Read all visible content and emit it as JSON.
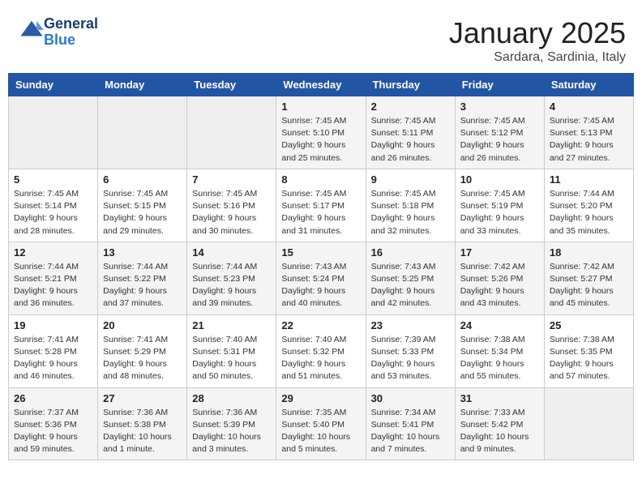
{
  "header": {
    "logo_line1": "General",
    "logo_line2": "Blue",
    "month": "January 2025",
    "location": "Sardara, Sardinia, Italy"
  },
  "weekdays": [
    "Sunday",
    "Monday",
    "Tuesday",
    "Wednesday",
    "Thursday",
    "Friday",
    "Saturday"
  ],
  "weeks": [
    [
      {
        "day": "",
        "info": ""
      },
      {
        "day": "",
        "info": ""
      },
      {
        "day": "",
        "info": ""
      },
      {
        "day": "1",
        "info": "Sunrise: 7:45 AM\nSunset: 5:10 PM\nDaylight: 9 hours and 25 minutes."
      },
      {
        "day": "2",
        "info": "Sunrise: 7:45 AM\nSunset: 5:11 PM\nDaylight: 9 hours and 26 minutes."
      },
      {
        "day": "3",
        "info": "Sunrise: 7:45 AM\nSunset: 5:12 PM\nDaylight: 9 hours and 26 minutes."
      },
      {
        "day": "4",
        "info": "Sunrise: 7:45 AM\nSunset: 5:13 PM\nDaylight: 9 hours and 27 minutes."
      }
    ],
    [
      {
        "day": "5",
        "info": "Sunrise: 7:45 AM\nSunset: 5:14 PM\nDaylight: 9 hours and 28 minutes."
      },
      {
        "day": "6",
        "info": "Sunrise: 7:45 AM\nSunset: 5:15 PM\nDaylight: 9 hours and 29 minutes."
      },
      {
        "day": "7",
        "info": "Sunrise: 7:45 AM\nSunset: 5:16 PM\nDaylight: 9 hours and 30 minutes."
      },
      {
        "day": "8",
        "info": "Sunrise: 7:45 AM\nSunset: 5:17 PM\nDaylight: 9 hours and 31 minutes."
      },
      {
        "day": "9",
        "info": "Sunrise: 7:45 AM\nSunset: 5:18 PM\nDaylight: 9 hours and 32 minutes."
      },
      {
        "day": "10",
        "info": "Sunrise: 7:45 AM\nSunset: 5:19 PM\nDaylight: 9 hours and 33 minutes."
      },
      {
        "day": "11",
        "info": "Sunrise: 7:44 AM\nSunset: 5:20 PM\nDaylight: 9 hours and 35 minutes."
      }
    ],
    [
      {
        "day": "12",
        "info": "Sunrise: 7:44 AM\nSunset: 5:21 PM\nDaylight: 9 hours and 36 minutes."
      },
      {
        "day": "13",
        "info": "Sunrise: 7:44 AM\nSunset: 5:22 PM\nDaylight: 9 hours and 37 minutes."
      },
      {
        "day": "14",
        "info": "Sunrise: 7:44 AM\nSunset: 5:23 PM\nDaylight: 9 hours and 39 minutes."
      },
      {
        "day": "15",
        "info": "Sunrise: 7:43 AM\nSunset: 5:24 PM\nDaylight: 9 hours and 40 minutes."
      },
      {
        "day": "16",
        "info": "Sunrise: 7:43 AM\nSunset: 5:25 PM\nDaylight: 9 hours and 42 minutes."
      },
      {
        "day": "17",
        "info": "Sunrise: 7:42 AM\nSunset: 5:26 PM\nDaylight: 9 hours and 43 minutes."
      },
      {
        "day": "18",
        "info": "Sunrise: 7:42 AM\nSunset: 5:27 PM\nDaylight: 9 hours and 45 minutes."
      }
    ],
    [
      {
        "day": "19",
        "info": "Sunrise: 7:41 AM\nSunset: 5:28 PM\nDaylight: 9 hours and 46 minutes."
      },
      {
        "day": "20",
        "info": "Sunrise: 7:41 AM\nSunset: 5:29 PM\nDaylight: 9 hours and 48 minutes."
      },
      {
        "day": "21",
        "info": "Sunrise: 7:40 AM\nSunset: 5:31 PM\nDaylight: 9 hours and 50 minutes."
      },
      {
        "day": "22",
        "info": "Sunrise: 7:40 AM\nSunset: 5:32 PM\nDaylight: 9 hours and 51 minutes."
      },
      {
        "day": "23",
        "info": "Sunrise: 7:39 AM\nSunset: 5:33 PM\nDaylight: 9 hours and 53 minutes."
      },
      {
        "day": "24",
        "info": "Sunrise: 7:38 AM\nSunset: 5:34 PM\nDaylight: 9 hours and 55 minutes."
      },
      {
        "day": "25",
        "info": "Sunrise: 7:38 AM\nSunset: 5:35 PM\nDaylight: 9 hours and 57 minutes."
      }
    ],
    [
      {
        "day": "26",
        "info": "Sunrise: 7:37 AM\nSunset: 5:36 PM\nDaylight: 9 hours and 59 minutes."
      },
      {
        "day": "27",
        "info": "Sunrise: 7:36 AM\nSunset: 5:38 PM\nDaylight: 10 hours and 1 minute."
      },
      {
        "day": "28",
        "info": "Sunrise: 7:36 AM\nSunset: 5:39 PM\nDaylight: 10 hours and 3 minutes."
      },
      {
        "day": "29",
        "info": "Sunrise: 7:35 AM\nSunset: 5:40 PM\nDaylight: 10 hours and 5 minutes."
      },
      {
        "day": "30",
        "info": "Sunrise: 7:34 AM\nSunset: 5:41 PM\nDaylight: 10 hours and 7 minutes."
      },
      {
        "day": "31",
        "info": "Sunrise: 7:33 AM\nSunset: 5:42 PM\nDaylight: 10 hours and 9 minutes."
      },
      {
        "day": "",
        "info": ""
      }
    ]
  ]
}
